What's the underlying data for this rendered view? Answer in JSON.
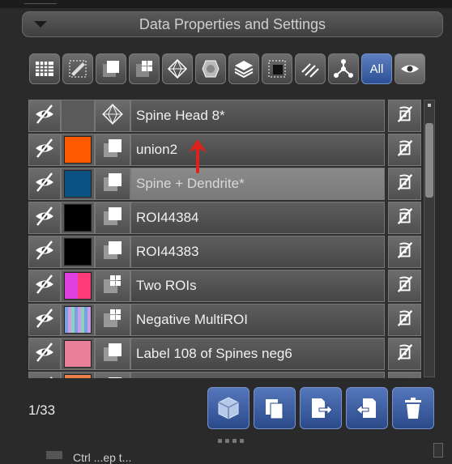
{
  "panel": {
    "title": "Data Properties and Settings"
  },
  "toolbar": {
    "all_label": "All"
  },
  "rows": [
    {
      "name": "Spine Head 8*",
      "color": "",
      "type": "surface-icon",
      "selected": false
    },
    {
      "name": "union2",
      "color": "#ff5a00",
      "type": "single-roi-icon",
      "selected": false
    },
    {
      "name": "Spine + Dendrite*",
      "color": "#0a5283",
      "type": "single-roi-icon",
      "selected": true
    },
    {
      "name": "ROI44384",
      "color": "#000000",
      "type": "single-roi-icon",
      "selected": false
    },
    {
      "name": "ROI44383",
      "color": "#000000",
      "type": "single-roi-icon",
      "selected": false
    },
    {
      "name": "Two ROIs",
      "color": "#e040e0",
      "type": "multi-roi-icon",
      "selected": false
    },
    {
      "name": "Negative MultiROI",
      "color": "#a8a8d0",
      "type": "multi-roi-icon",
      "selected": false
    },
    {
      "name": "Label 108 of Spines neg6",
      "color": "#e8809a",
      "type": "single-roi-icon",
      "selected": false
    },
    {
      "name": "",
      "color": "#e8804a",
      "type": "single-roi-icon",
      "selected": false
    }
  ],
  "footer": {
    "count": "1/33",
    "partial_text": "Ctrl ...ep t..."
  },
  "annotation": {
    "color": "#e0201a"
  }
}
